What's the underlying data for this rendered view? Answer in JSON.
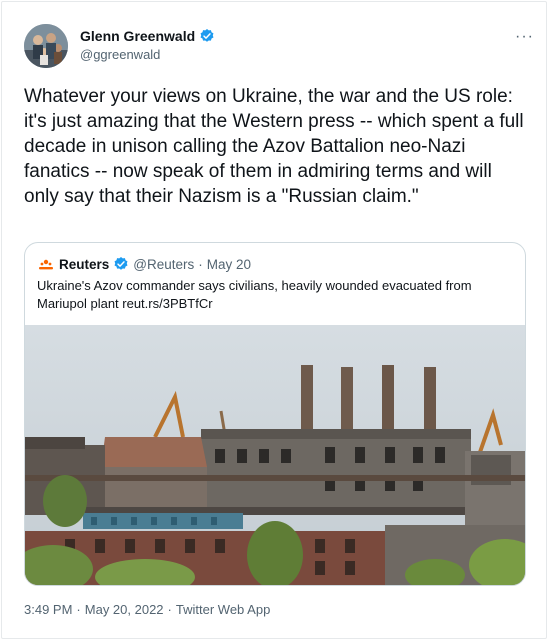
{
  "author": {
    "display_name": "Glenn Greenwald",
    "handle": "@ggreenwald",
    "verified_icon": "verified-badge-icon",
    "avatar_icon": "profile-photo"
  },
  "more_label": "···",
  "tweet_text": "Whatever your views on Ukraine, the war and the US role: it's just amazing that the Western press -- which spent a full decade in unison calling the Azov Battalion neo-Nazi fanatics -- now speak of them in admiring terms and will only say that their Nazism is a \"Russian claim.\"",
  "quoted": {
    "display_name": "Reuters",
    "handle": "@Reuters",
    "separator": "·",
    "date": "May 20",
    "text": "Ukraine's Azov commander says civilians, heavily wounded evacuated from Mariupol plant reut.rs/3PBTfCr",
    "image": "damaged-steel-plant-photo"
  },
  "meta": {
    "time": "3:49 PM",
    "sep1": "·",
    "date": "May 20, 2022",
    "sep2": "·",
    "app": "Twitter Web App"
  },
  "colors": {
    "verified_blue": "#1d9bf0",
    "secondary_text": "#536471",
    "border": "#cfd9de"
  }
}
